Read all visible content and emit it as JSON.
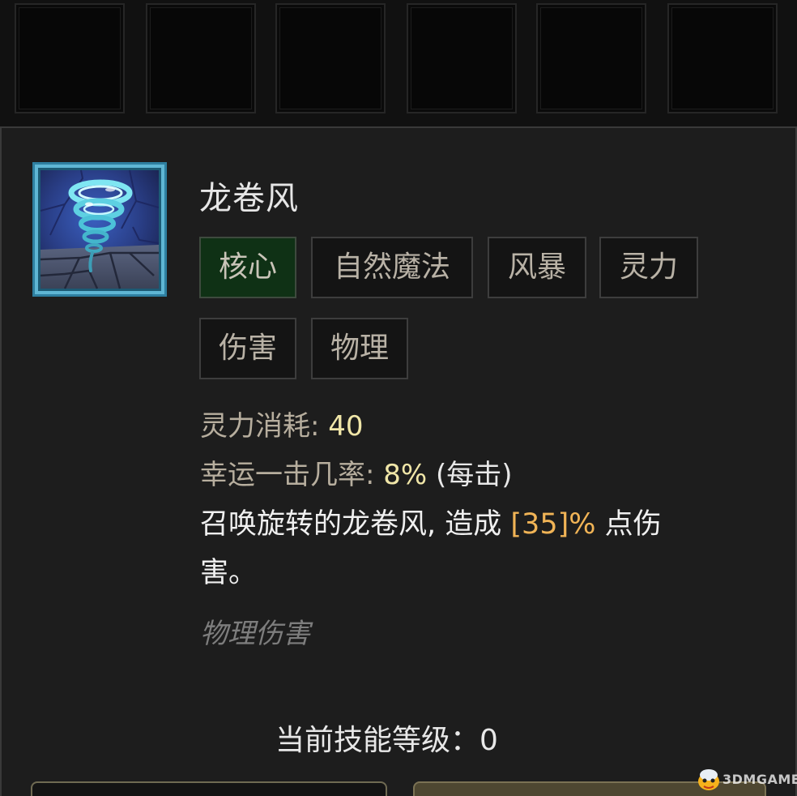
{
  "skill": {
    "name": "龙卷风",
    "icon": "tornado-icon",
    "tags": [
      "核心",
      "自然魔法",
      "风暴",
      "灵力",
      "伤害",
      "物理"
    ],
    "stats": {
      "cost_label": "灵力消耗: ",
      "cost_value": "40",
      "lucky_label": "幸运一击几率: ",
      "lucky_value": "8%",
      "lucky_suffix": " (每击)"
    },
    "description": {
      "line1_prefix": "召唤旋转的龙卷风, 造成 ",
      "highlight": "[35]%",
      "line1_suffix": " 点伤",
      "line2": "害。"
    },
    "damage_type": "物理伤害",
    "level_label": "当前技能等级：",
    "level_value": "0"
  },
  "watermark": {
    "logo": "3dm-mascot-icon",
    "text": "3DMGAME"
  },
  "colors": {
    "panel_bg": "#1d1d1d",
    "core_tag_bg": "#0f3115",
    "stat_value": "#f0e6a8",
    "highlight": "#f1b456",
    "icon_border": "#3d8fb0"
  }
}
